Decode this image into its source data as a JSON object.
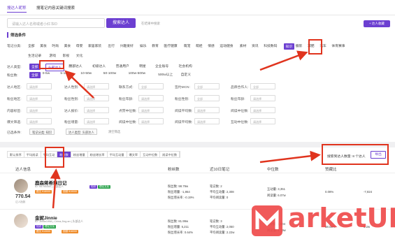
{
  "top_tabs": [
    "搜达人昵称",
    "搜笔记内容关键词搜索"
  ],
  "search": {
    "placeholder": "请输入达人名称或者小红书ID",
    "button": "搜索达人",
    "hint": "在结果中搜索",
    "add_button": "+ 达人收藏"
  },
  "filter_title": "筛选条件",
  "note_category": {
    "label": "笔记分类:",
    "items": [
      "全部",
      "美妆",
      "时尚",
      "美食",
      "母婴",
      "家居家装",
      "出行",
      "兴趣爱好",
      "娱乐",
      "教育",
      "医疗健康",
      "萌宠",
      "萌娃",
      "情感",
      "运动健身",
      "素材",
      "资讯",
      "科技数码",
      "知识",
      "摄影",
      "减肥",
      "汽车",
      "体育赛事"
    ],
    "items_row2": [
      "生活记录",
      "游戏",
      "影视",
      "文化"
    ],
    "selected": "知识"
  },
  "talent_type": {
    "label": "达人类型:",
    "items": [
      "全部",
      "头部达人",
      "腰部达人",
      "初级达人",
      "普通用户",
      "明星",
      "企业账号",
      "社会机构"
    ],
    "selected": "头部达人"
  },
  "fans_count": {
    "label": "粉丝数:",
    "items": [
      "全部",
      "0-5w",
      "5-10w",
      "10-50w",
      "50-100w",
      "100w-500w",
      "500w以上",
      "自定义"
    ]
  },
  "dropdowns": [
    {
      "label": "达人地区:",
      "placeholder": "请选择"
    },
    {
      "label": "达人性别:",
      "placeholder": "请选择"
    },
    {
      "label": "联系方式:",
      "placeholder": "全部"
    },
    {
      "label": "签约MCN:",
      "placeholder": "全部"
    },
    {
      "label": "品牌合作人:",
      "placeholder": "全部"
    },
    {
      "label": "粉丝地区:",
      "placeholder": "请选择"
    },
    {
      "label": "粉丝性别:",
      "placeholder": "请选择"
    },
    {
      "label": "粉丝年龄:",
      "placeholder": "请选择"
    },
    {
      "label": "粉丝性别:",
      "placeholder": "全部"
    },
    {
      "label": "粉丝年龄:",
      "placeholder": "请选择"
    },
    {
      "label": "内容标签:",
      "placeholder": "请选择"
    },
    {
      "label": "达人报价:",
      "placeholder": "请选择"
    },
    {
      "label": "点赞中位数:",
      "placeholder": "请选择"
    },
    {
      "label": "阅读平均数:",
      "placeholder": "请选择"
    },
    {
      "label": "阅读中位数:",
      "placeholder": "请选择"
    },
    {
      "label": "爆文筛选:",
      "placeholder": "请选择"
    },
    {
      "label": "粉丝增量:",
      "placeholder": "请选择"
    },
    {
      "label": "阅读中位数:",
      "placeholder": "请选择"
    },
    {
      "label": "阅读平均数:",
      "placeholder": "请选择"
    },
    {
      "label": "互动中位数:",
      "placeholder": "请选择"
    }
  ],
  "chips_label": "已选条件:",
  "chips": [
    "笔记分类: 知识",
    "达人类型: 头部达人"
  ],
  "clear_label": "清空筛选",
  "sort_tabs": [
    "默认排序",
    "平均阅读",
    "平均互动",
    "粉丝数",
    "粉丝增量",
    "粉丝增长率",
    "平均互动量",
    "爆文率",
    "互动中位数",
    "阅读中位数"
  ],
  "sort_selected": "粉丝数",
  "result_count": "搜索到达人数量: 8 个达人",
  "export_label": "导出",
  "table_headers": [
    "达人信息",
    "粉丝数",
    "近10日笔记",
    "中位数",
    "赞藏比"
  ],
  "rows": [
    {
      "name": "鹿森蒋希琳日记",
      "id": "ID: 95796480 | 头部达人",
      "tag1": "知识",
      "tag2": "理论文化",
      "price1": "图文 ¥18000",
      "price2": "视频 ¥19000",
      "score": "770.54",
      "score_label": "达人指数",
      "fans": "粉丝数: 98.79w",
      "fans_inc": "粉丝增量: -1,864",
      "fans_rate": "粉丝增长率: -0.19%",
      "notes": "笔记数: 2",
      "avg_read": "平均互动量: 2,308",
      "avg_like": "平均阅读量: 0",
      "med_int": "互动量: 3,351",
      "med_read": "阅读量: 6.07w",
      "ratio": "0.08%",
      "trend": "-7,824"
    },
    {
      "name": "金妮Jinnie",
      "id": "ID: Jinnie1998 | China,Jing an | 头部达人",
      "tag1": "知识",
      "tag2": "理论文化",
      "price1": "图文 ¥13000",
      "price2": "视频 ¥16000",
      "score": "",
      "score_label": "",
      "fans": "粉丝数: 81.99w",
      "fans_inc": "粉丝增量: 5,211",
      "fans_rate": "粉丝增长率: 0.64%",
      "notes": "笔记数: 3",
      "avg_read": "平均互动量: 2,050",
      "avg_like": "平均阅读量: 2.22w",
      "med_int": "互动量: 1,004",
      "med_read": "阅读量: 1.19w",
      "ratio": "58.00%",
      "trend": "3.2w"
    }
  ],
  "watermark": "arketUP",
  "colors": {
    "accent": "#6c3fd1",
    "annotation": "#e0341e",
    "watermark": "#ef4b4b"
  }
}
